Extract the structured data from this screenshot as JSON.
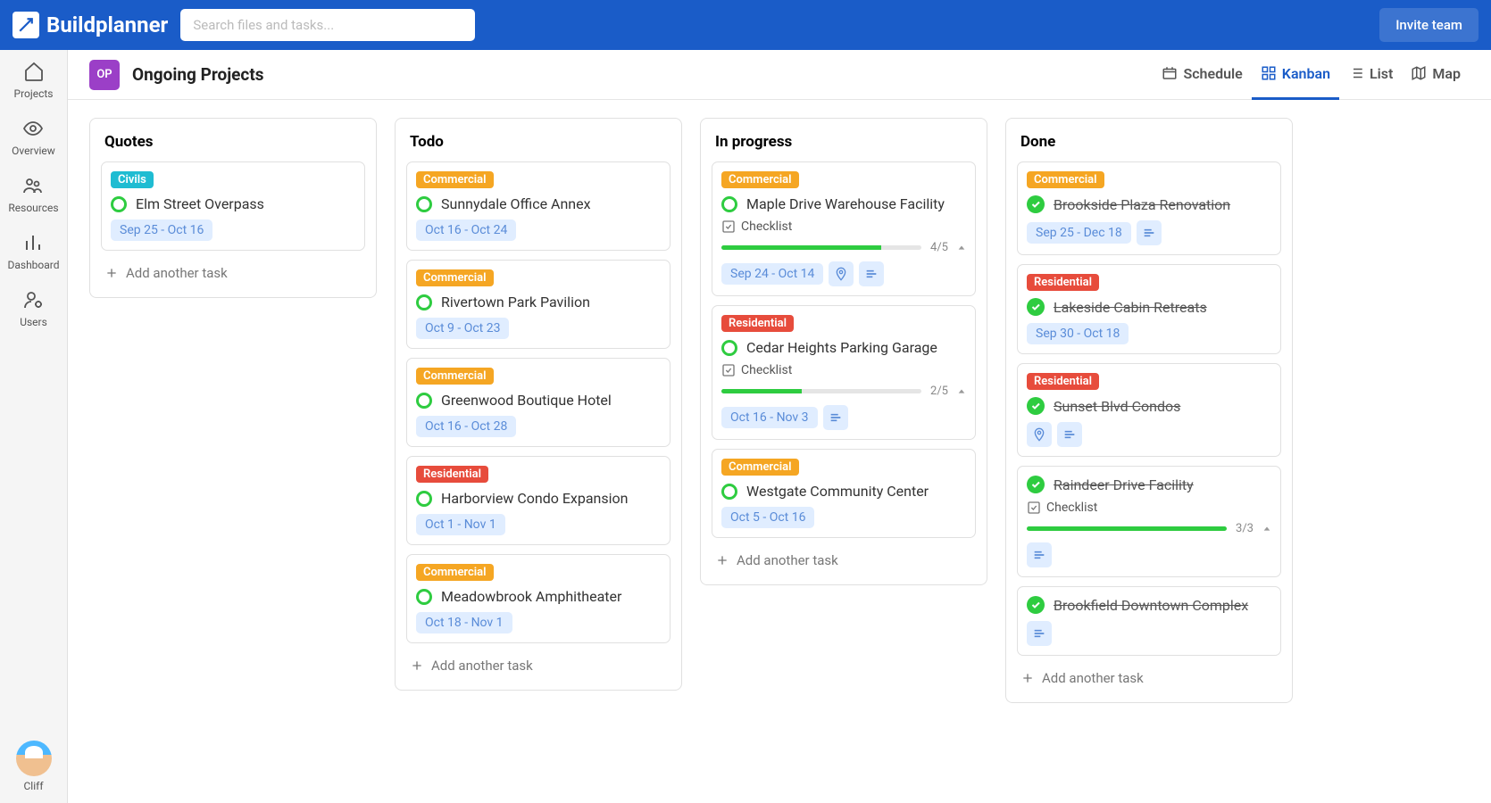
{
  "app_name": "Buildplanner",
  "search_placeholder": "Search files and tasks...",
  "invite_label": "Invite team",
  "sidebar": {
    "items": [
      {
        "label": "Projects"
      },
      {
        "label": "Overview"
      },
      {
        "label": "Resources"
      },
      {
        "label": "Dashboard"
      },
      {
        "label": "Users"
      }
    ],
    "user": "Cliff"
  },
  "header": {
    "icon_text": "OP",
    "title": "Ongoing Projects",
    "views": [
      {
        "label": "Schedule",
        "active": false
      },
      {
        "label": "Kanban",
        "active": true
      },
      {
        "label": "List",
        "active": false
      },
      {
        "label": "Map",
        "active": false
      }
    ]
  },
  "board": {
    "columns": [
      {
        "title": "Quotes",
        "add_label": "Add another task",
        "cards": [
          {
            "tag": "Civils",
            "tag_class": "civils",
            "name": "Elm Street Overpass",
            "done": false,
            "date": "Sep 25 - Oct 16",
            "checklist": null,
            "icons": []
          }
        ]
      },
      {
        "title": "Todo",
        "add_label": "Add another task",
        "cards": [
          {
            "tag": "Commercial",
            "tag_class": "commercial",
            "name": "Sunnydale Office Annex",
            "done": false,
            "date": "Oct 16 - Oct 24",
            "checklist": null,
            "icons": []
          },
          {
            "tag": "Commercial",
            "tag_class": "commercial",
            "name": "Rivertown Park Pavilion",
            "done": false,
            "date": "Oct 9 - Oct 23",
            "checklist": null,
            "icons": []
          },
          {
            "tag": "Commercial",
            "tag_class": "commercial",
            "name": "Greenwood Boutique Hotel",
            "done": false,
            "date": "Oct 16 - Oct 28",
            "checklist": null,
            "icons": []
          },
          {
            "tag": "Residential",
            "tag_class": "residential",
            "name": "Harborview Condo Expansion",
            "done": false,
            "date": "Oct 1 - Nov 1",
            "checklist": null,
            "icons": []
          },
          {
            "tag": "Commercial",
            "tag_class": "commercial",
            "name": "Meadowbrook Amphitheater",
            "done": false,
            "date": "Oct 18 - Nov 1",
            "checklist": null,
            "icons": []
          }
        ]
      },
      {
        "title": "In progress",
        "add_label": "Add another task",
        "cards": [
          {
            "tag": "Commercial",
            "tag_class": "commercial",
            "name": "Maple Drive Warehouse Facility",
            "done": false,
            "date": "Sep 24 - Oct 14",
            "checklist": {
              "label": "Checklist",
              "done": 4,
              "total": 5
            },
            "icons": [
              "location",
              "notes"
            ]
          },
          {
            "tag": "Residential",
            "tag_class": "residential",
            "name": "Cedar Heights Parking Garage",
            "done": false,
            "date": "Oct 16 - Nov 3",
            "checklist": {
              "label": "Checklist",
              "done": 2,
              "total": 5
            },
            "icons": [
              "notes"
            ]
          },
          {
            "tag": "Commercial",
            "tag_class": "commercial",
            "name": "Westgate Community Center",
            "done": false,
            "date": "Oct 5 - Oct 16",
            "checklist": null,
            "icons": []
          }
        ]
      },
      {
        "title": "Done",
        "add_label": "Add another task",
        "cards": [
          {
            "tag": "Commercial",
            "tag_class": "commercial",
            "name": "Brookside Plaza Renovation",
            "done": true,
            "date": "Sep 25 - Dec 18",
            "checklist": null,
            "icons": [
              "notes"
            ]
          },
          {
            "tag": "Residential",
            "tag_class": "residential",
            "name": "Lakeside Cabin Retreats",
            "done": true,
            "date": "Sep 30 - Oct 18",
            "checklist": null,
            "icons": []
          },
          {
            "tag": "Residential",
            "tag_class": "residential",
            "name": "Sunset Blvd Condos",
            "done": true,
            "date": null,
            "checklist": null,
            "icons": [
              "location",
              "notes"
            ]
          },
          {
            "tag": null,
            "tag_class": null,
            "name": "Raindeer Drive Facility",
            "done": true,
            "date": null,
            "checklist": {
              "label": "Checklist",
              "done": 3,
              "total": 3
            },
            "icons": [
              "notes"
            ]
          },
          {
            "tag": null,
            "tag_class": null,
            "name": "Brookfield Downtown Complex",
            "done": true,
            "date": null,
            "checklist": null,
            "icons": [
              "notes"
            ]
          }
        ]
      }
    ]
  }
}
